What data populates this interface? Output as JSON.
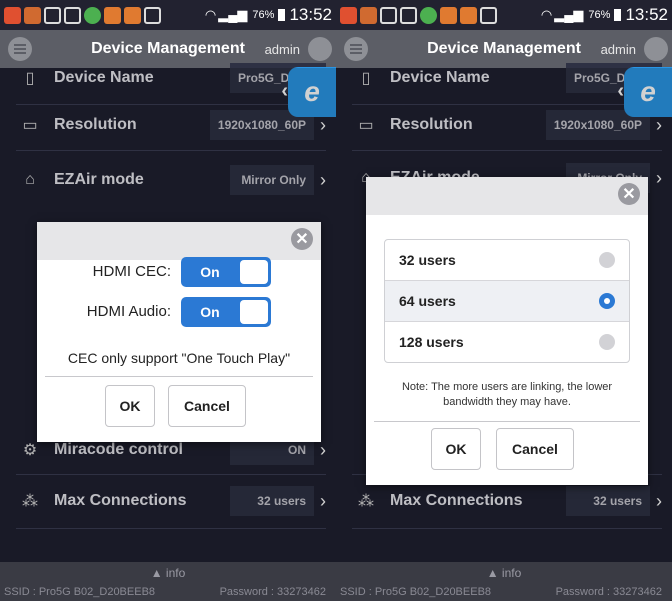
{
  "status_bar": {
    "battery": "76%",
    "time": "13:52",
    "time_right": "13:52"
  },
  "header": {
    "title": "Device Management",
    "user": "admin"
  },
  "left_rows": [
    {
      "label": "Device Name",
      "value": ""
    },
    {
      "label": "Resolution",
      "value": "1920x1080_60P"
    },
    {
      "label": "EZAir mode",
      "value": "Mirror Only"
    },
    {
      "label": "Miracode control",
      "value": "ON"
    },
    {
      "label": "Max Connections",
      "value": "32 users"
    }
  ],
  "right_rows": [
    {
      "label": "Device Name",
      "value": ""
    },
    {
      "label": "Resolution",
      "value": "1920x1080_60P"
    },
    {
      "label": "EZAir mode",
      "value": "Mirror Only"
    },
    {
      "label": "Max Connections",
      "value": "32 users"
    }
  ],
  "footer": {
    "info": "info",
    "ssid": "SSID : Pro5G B02_D20BEEB8",
    "password": "Password : 33273462"
  },
  "cec_dialog": {
    "hdmi_cec_label": "HDMI CEC:",
    "hdmi_cec_state": "On",
    "hdmi_audio_label": "HDMI Audio:",
    "hdmi_audio_state": "On",
    "note": "CEC only support \"One Touch Play\"",
    "ok": "OK",
    "cancel": "Cancel"
  },
  "users_dialog": {
    "options": [
      "32 users",
      "64 users",
      "128 users"
    ],
    "selected_index": 1,
    "note": "Note: The more users are linking, the lower bandwidth they may have.",
    "ok": "OK",
    "cancel": "Cancel"
  },
  "colors": {
    "accent": "#2b79d4",
    "header": "#5c5e66",
    "background": "#1f2030",
    "badge": "#2a96e6"
  },
  "icons": {
    "menu": "menu-icon",
    "close": "close-icon",
    "chevron": "chevron-right-icon",
    "info": "chevron-up-icon"
  }
}
